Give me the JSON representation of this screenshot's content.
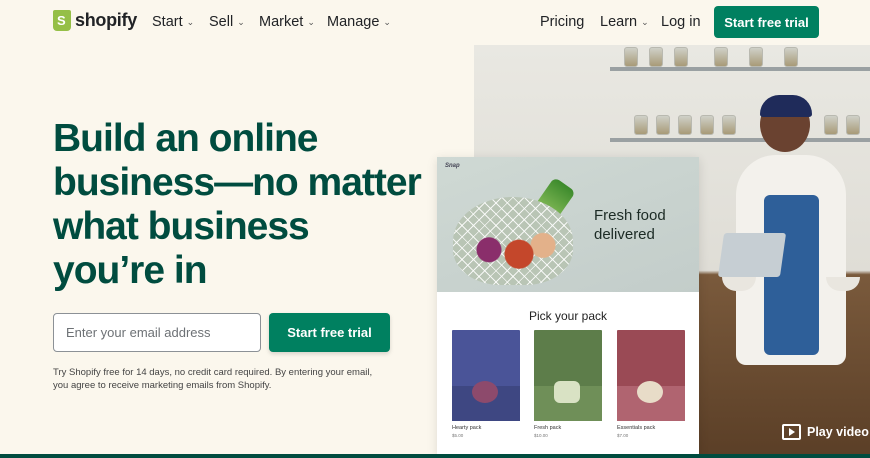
{
  "brand": {
    "name": "shopify"
  },
  "nav": {
    "left_items": [
      {
        "label": "Start",
        "chevron": "chevron-down-icon"
      },
      {
        "label": "Sell",
        "chevron": "chevron-down-icon"
      },
      {
        "label": "Market",
        "chevron": "chevron-down-icon"
      },
      {
        "label": "Manage",
        "chevron": "chevron-down-icon"
      }
    ],
    "pricing": "Pricing",
    "learn": "Learn",
    "login": "Log in",
    "cta": "Start free trial"
  },
  "hero": {
    "headline": "Build an online business—no matter what business you’re in",
    "email_placeholder": "Enter your email address",
    "cta": "Start free trial",
    "disclaimer": "Try Shopify free for 14 days, no credit card required. By entering your email, you agree to receive marketing emails from Shopify."
  },
  "store_card": {
    "brand": "Snap",
    "tagline": "Fresh food delivered",
    "section_title": "Pick your pack",
    "packs": [
      {
        "name": "Hearty pack",
        "price": "$5.00"
      },
      {
        "name": "Fresh pack",
        "price": "$10.00"
      },
      {
        "name": "Essentials pack",
        "price": "$7.00"
      }
    ]
  },
  "video": {
    "label": "Play video",
    "icon": "play-icon"
  },
  "colors": {
    "primary": "#008060",
    "headline": "#004c3f",
    "background": "#fbf7ed"
  }
}
